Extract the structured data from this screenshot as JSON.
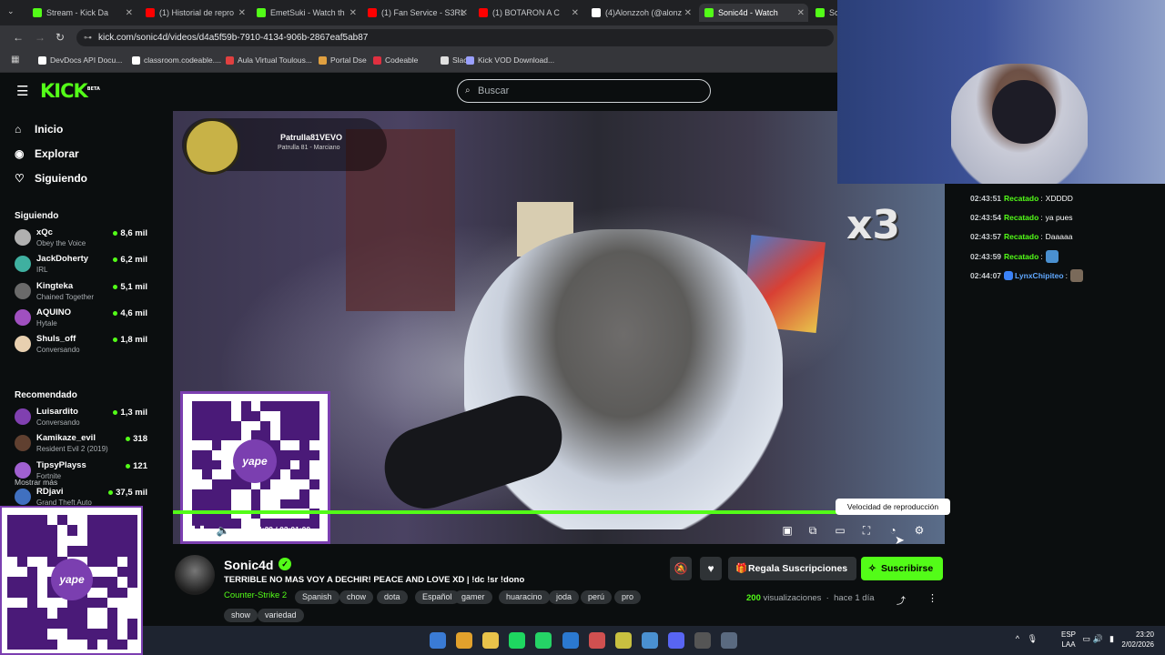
{
  "browser": {
    "tabs": [
      {
        "label": "Stream - Kick Da",
        "color": "#53fc18",
        "active": false
      },
      {
        "label": "(1) Historial de repro",
        "color": "#ff0000",
        "active": false
      },
      {
        "label": "EmetSuki - Watch th",
        "color": "#53fc18",
        "active": false
      },
      {
        "label": "(1) Fan Service - S3RL",
        "color": "#ff0000",
        "active": false
      },
      {
        "label": "(1) BOTARON A C",
        "color": "#ff0000",
        "active": false
      },
      {
        "label": "(4)Alonzzoh (@alonz",
        "color": "#ffffff",
        "active": false
      },
      {
        "label": "Sonic4d - Watch",
        "color": "#53fc18",
        "active": true
      },
      {
        "label": "So",
        "color": "#53fc18",
        "active": false
      }
    ],
    "url": "kick.com/sonic4d/videos/d4a5f59b-7910-4134-906b-2867eaf5ab87",
    "bookmarks": [
      {
        "label": "DevDocs API Docu...",
        "color": "#ffffff"
      },
      {
        "label": "classroom.codeable....",
        "color": "#ffffff"
      },
      {
        "label": "Aula Virtual Toulous...",
        "color": "#e04040"
      },
      {
        "label": "Portal Dse",
        "color": "#e0a040"
      },
      {
        "label": "Codeable",
        "color": "#e03040"
      },
      {
        "label": "Slack",
        "color": "#e0e0e0"
      },
      {
        "label": "Kick VOD Download...",
        "color": "#9aa0ff"
      }
    ]
  },
  "kick": {
    "logo": "KICK",
    "beta": "BETA",
    "search_placeholder": "Buscar"
  },
  "sidebar": {
    "nav": [
      {
        "label": "Inicio",
        "icon": "home-icon",
        "glyph": "⌂"
      },
      {
        "label": "Explorar",
        "icon": "compass-icon",
        "glyph": "◉"
      },
      {
        "label": "Siguiendo",
        "icon": "heart-icon",
        "glyph": "♡"
      }
    ],
    "following_header": "Siguiendo",
    "following": [
      {
        "name": "xQc",
        "game": "Obey the Voice",
        "viewers": "8,6 mil",
        "color": "#b0b0b0"
      },
      {
        "name": "JackDoherty",
        "game": "IRL",
        "viewers": "6,2 mil",
        "color": "#3fb0a0"
      },
      {
        "name": "Kingteka",
        "game": "Chained Together",
        "viewers": "5,1 mil",
        "color": "#6a6a6a"
      },
      {
        "name": "AQUINO",
        "game": "Hytale",
        "viewers": "4,6 mil",
        "color": "#a050c0"
      },
      {
        "name": "Shuls_off",
        "game": "Conversando",
        "viewers": "1,8 mil",
        "color": "#e8d0b0"
      }
    ],
    "more": "Mostrar más",
    "recommended_header": "Recomendado",
    "recommended": [
      {
        "name": "Luisardito",
        "game": "Conversando",
        "viewers": "1,3 mil",
        "color": "#8040b0"
      },
      {
        "name": "Kamikaze_evil",
        "game": "Resident Evil 2 (2019)",
        "viewers": "318",
        "color": "#604030"
      },
      {
        "name": "TipsyPlayss",
        "game": "Fortnite",
        "viewers": "121",
        "color": "#a060d0"
      },
      {
        "name": "RDjavi",
        "game": "Grand Theft Auto",
        "viewers": "37,5 mil",
        "color": "#4070c0"
      }
    ]
  },
  "player": {
    "overlay_name": "Patrulla81VEVO",
    "overlay_sub": "Patrulla 81 - Marciano",
    "multiplier": "x3",
    "time": "02:44:29 / 03:01:00",
    "progress": 0.909,
    "tooltip": "Velocidad de reproducción",
    "qr_label": "yape"
  },
  "video": {
    "channel": "Sonic4d",
    "title": "TERRIBLE NO MAS VOY A DECHIR! PEACE AND LOVE XD | !dc !sr !dono",
    "category": "Counter-Strike 2",
    "tags": [
      "Spanish",
      "chow",
      "dota",
      "Español",
      "gamer",
      "huaracino",
      "joda",
      "perú",
      "pro",
      "show",
      "variedad"
    ],
    "gift_label": "Regala Suscripciones",
    "subscribe_label": "Suscribirse",
    "views_count": "200",
    "views_label": "visualizaciones",
    "date": "hace 1 día"
  },
  "chat": [
    {
      "time": "02:43:51",
      "user": "Recatado",
      "user_color": "#53fc18",
      "text": "XDDDD",
      "badge": false,
      "emote": false
    },
    {
      "time": "02:43:54",
      "user": "Recatado",
      "user_color": "#53fc18",
      "text": "ya pues",
      "badge": false,
      "emote": false
    },
    {
      "time": "02:43:57",
      "user": "Recatado",
      "user_color": "#53fc18",
      "text": "Daaaaa",
      "badge": false,
      "emote": false
    },
    {
      "time": "02:43:59",
      "user": "Recatado",
      "user_color": "#53fc18",
      "text": "",
      "badge": false,
      "emote": true
    },
    {
      "time": "02:44:07",
      "user": "LynxChipiteo",
      "user_color": "#60a8ff",
      "text": "",
      "badge": true,
      "emote": true
    }
  ],
  "taskbar": {
    "lang1": "ESP",
    "lang2": "LAA",
    "time": "23:20",
    "date": "2/02/2026"
  }
}
